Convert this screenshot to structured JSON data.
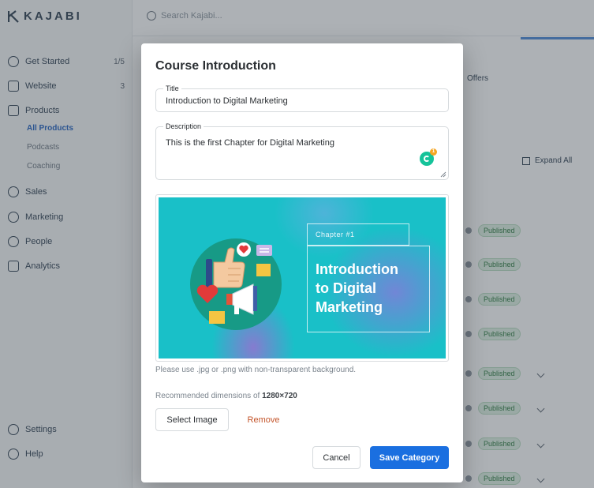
{
  "background": {
    "logo": "KAJABI",
    "search_placeholder": "Search Kajabi...",
    "nav": [
      {
        "label": "Get Started",
        "count": "1/5"
      },
      {
        "label": "Website",
        "count": "3"
      },
      {
        "label": "Products",
        "count": ""
      },
      {
        "label": "Sales",
        "count": ""
      },
      {
        "label": "Marketing",
        "count": ""
      },
      {
        "label": "People",
        "count": ""
      },
      {
        "label": "Analytics",
        "count": ""
      },
      {
        "label": "Settings",
        "count": ""
      },
      {
        "label": "Help",
        "count": ""
      }
    ],
    "products_sub": [
      "All Products",
      "Podcasts",
      "Coaching"
    ],
    "offers_label": "Offers",
    "expand_all": "Expand All",
    "status_label": "Published"
  },
  "modal": {
    "title": "Course Introduction",
    "title_field": {
      "label": "Title",
      "value": "Introduction to Digital Marketing"
    },
    "description_field": {
      "label": "Description",
      "value": "This is the first Chapter for Digital Marketing"
    },
    "grammarly_badge": "1",
    "image": {
      "chapter_text": "Chapter #1",
      "heading_line1": "Introduction",
      "heading_line2": "to Digital",
      "heading_line3": "Marketing"
    },
    "hint_format": "Please use .jpg or .png with non-transparent background.",
    "hint_dimensions_prefix": "Recommended dimensions of ",
    "hint_dimensions_value": "1280×720",
    "select_image_label": "Select Image",
    "remove_label": "Remove",
    "cancel_label": "Cancel",
    "save_label": "Save Category"
  },
  "colors": {
    "primary": "#1a6fe0",
    "remove": "#c4552b",
    "cover_teal": "#19c0c8"
  }
}
